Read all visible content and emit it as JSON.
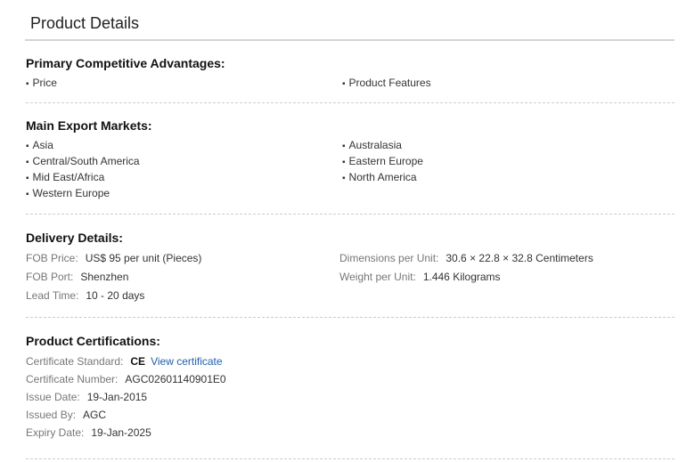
{
  "header": {
    "title": "Product Details"
  },
  "advantages": {
    "heading": "Primary Competitive Advantages:",
    "left": [
      "Price"
    ],
    "right": [
      "Product Features"
    ]
  },
  "markets": {
    "heading": "Main Export Markets:",
    "left": [
      "Asia",
      "Central/South America",
      "Mid East/Africa",
      "Western Europe"
    ],
    "right": [
      "Australasia",
      "Eastern Europe",
      "North America"
    ]
  },
  "delivery": {
    "heading": "Delivery Details:",
    "fob_price": {
      "label": "FOB Price:",
      "value": "US$ 95 per unit (Pieces)"
    },
    "fob_port": {
      "label": "FOB Port:",
      "value": "Shenzhen"
    },
    "lead_time": {
      "label": "Lead Time:",
      "value": "10 - 20 days"
    },
    "dimensions": {
      "label": "Dimensions per Unit:",
      "value": "30.6 × 22.8 × 32.8 Centimeters"
    },
    "weight": {
      "label": "Weight per Unit:",
      "value": "1.446 Kilograms"
    }
  },
  "certifications": {
    "heading": "Product Certifications:",
    "standard": {
      "label": "Certificate Standard:",
      "value": "CE",
      "link": "View certificate"
    },
    "number": {
      "label": "Certificate Number:",
      "value": "AGC02601140901E0"
    },
    "issue_date": {
      "label": "Issue Date:",
      "value": "19-Jan-2015"
    },
    "issued_by": {
      "label": "Issued By:",
      "value": "AGC"
    },
    "expiry_date": {
      "label": "Expiry Date:",
      "value": "19-Jan-2025"
    }
  }
}
